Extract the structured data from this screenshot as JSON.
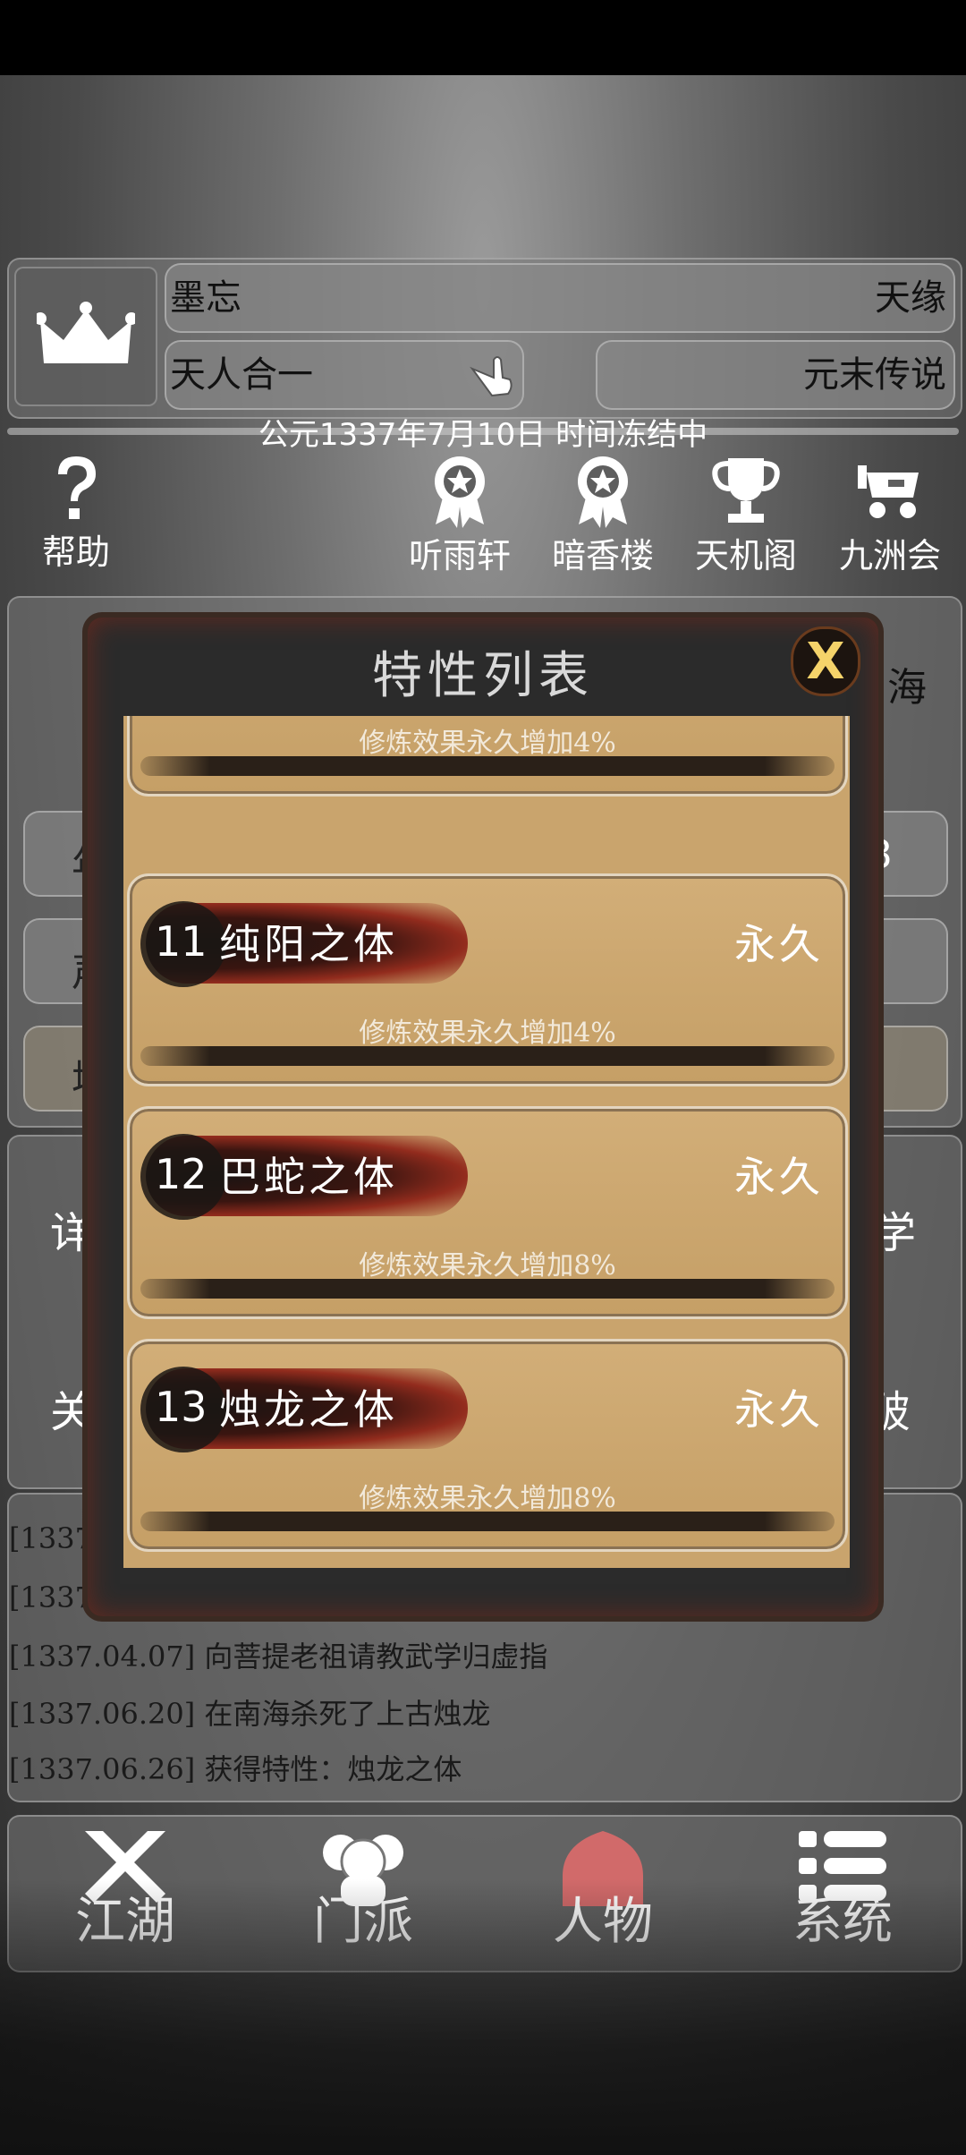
{
  "header": {
    "player_name": "墨忘",
    "fate": "天缘",
    "realm": "天人合一",
    "era": "元末传说",
    "date_status": "公元1337年7月10日 时间冻结中"
  },
  "top_icons": [
    {
      "label": "帮助",
      "icon": "question-icon"
    },
    {
      "label": "听雨轩",
      "icon": "badge-icon"
    },
    {
      "label": "暗香楼",
      "icon": "badge-icon"
    },
    {
      "label": "天机阁",
      "icon": "trophy-icon"
    },
    {
      "label": "九洲会",
      "icon": "cart-icon"
    }
  ],
  "side_fragments": {
    "right_top": "海",
    "left_1": "年",
    "right_1": "3",
    "left_2": "声",
    "left_3": "境",
    "left_4": "详",
    "right_4": "学",
    "left_5": "关",
    "right_5": "破",
    "log_partial_1": "[1337.",
    "log_partial_2": "[1337.0"
  },
  "log": [
    "[1337.04.07] 向菩提老祖请教武学归虚指",
    "[1337.06.20] 在南海杀死了上古烛龙",
    "[1337.06.26] 获得特性：烛龙之体"
  ],
  "modal": {
    "title": "特性列表",
    "close_label": "X",
    "partial_card_desc": "修炼效果永久增加4%",
    "traits": [
      {
        "num": "11",
        "name": "纯阳之体",
        "duration": "永久",
        "desc": "修炼效果永久增加4%"
      },
      {
        "num": "12",
        "name": "巴蛇之体",
        "duration": "永久",
        "desc": "修炼效果永久增加8%"
      },
      {
        "num": "13",
        "name": "烛龙之体",
        "duration": "永久",
        "desc": "修炼效果永久增加8%"
      }
    ]
  },
  "bottom_nav": [
    {
      "label": "江湖",
      "icon": "crossed-swords-icon",
      "active": false
    },
    {
      "label": "门派",
      "icon": "people-icon",
      "active": false
    },
    {
      "label": "人物",
      "icon": "house-icon",
      "active": true
    },
    {
      "label": "系统",
      "icon": "list-icon",
      "active": false
    }
  ],
  "colors": {
    "accent_red": "#d16a6a",
    "parchment": "#c9a46d",
    "modal_frame": "#2b2b2b"
  }
}
